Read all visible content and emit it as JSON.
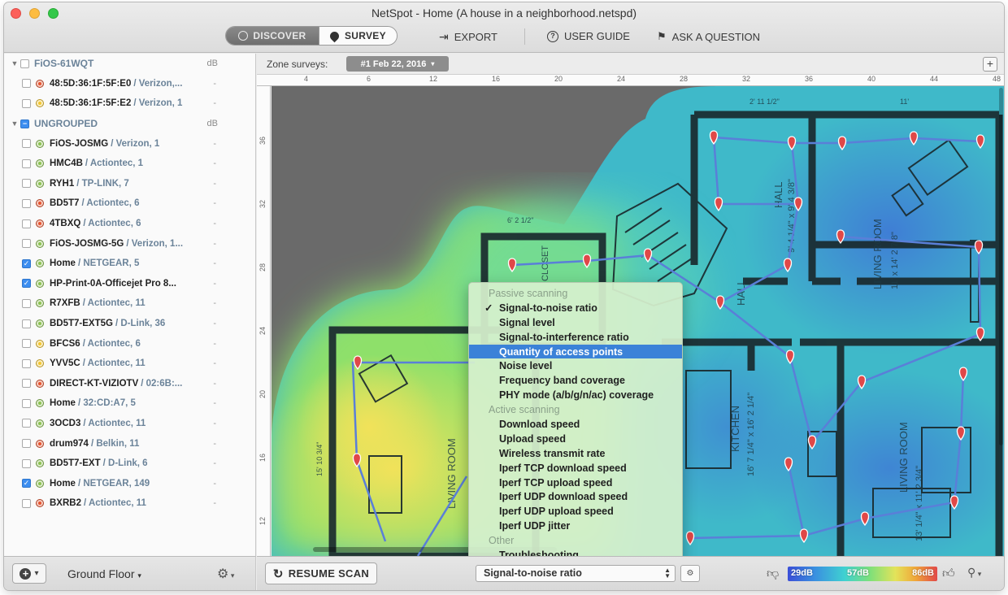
{
  "window": {
    "title": "NetSpot - Home (A house in a neighborhood.netspd)"
  },
  "toolbar": {
    "discover_label": "DISCOVER",
    "survey_label": "SURVEY",
    "export_label": "EXPORT",
    "user_guide_label": "USER GUIDE",
    "ask_label": "ASK A QUESTION"
  },
  "sidebar": {
    "groups": [
      {
        "name": "FiOS-61WQT",
        "unit": "dB",
        "items": [
          {
            "name": "48:5D:36:1F:5F:E0",
            "vendor": "/ Verizon,...",
            "value": "-",
            "color": "#e4542f",
            "checked": false
          },
          {
            "name": "48:5D:36:1F:5F:E2",
            "vendor": "/ Verizon, 1",
            "value": "-",
            "color": "#f2c531",
            "checked": false
          }
        ]
      },
      {
        "name": "UNGROUPED",
        "unit": "dB",
        "items": [
          {
            "name": "FiOS-JOSMG",
            "vendor": "/ Verizon, 1",
            "value": "-",
            "color": "#8cc152",
            "checked": false
          },
          {
            "name": "HMC4B",
            "vendor": "/ Actiontec, 1",
            "value": "-",
            "color": "#8cc152",
            "checked": false
          },
          {
            "name": "RYH1",
            "vendor": "/ TP-LINK, 7",
            "value": "-",
            "color": "#8cc152",
            "checked": false
          },
          {
            "name": "BD5T7",
            "vendor": "/ Actiontec, 6",
            "value": "-",
            "color": "#e4542f",
            "checked": false
          },
          {
            "name": "4TBXQ",
            "vendor": "/ Actiontec, 6",
            "value": "-",
            "color": "#e4542f",
            "checked": false
          },
          {
            "name": "FiOS-JOSMG-5G",
            "vendor": "/ Verizon, 1...",
            "value": "-",
            "color": "#8cc152",
            "checked": false
          },
          {
            "name": "Home",
            "vendor": "/ NETGEAR, 5",
            "value": "-",
            "color": "#8cc152",
            "checked": true
          },
          {
            "name": "HP-Print-0A-Officejet Pro 8...",
            "vendor": "",
            "value": "-",
            "color": "#8cc152",
            "checked": true
          },
          {
            "name": "R7XFB",
            "vendor": "/ Actiontec, 11",
            "value": "-",
            "color": "#8cc152",
            "checked": false
          },
          {
            "name": "BD5T7-EXT5G",
            "vendor": "/ D-Link, 36",
            "value": "-",
            "color": "#8cc152",
            "checked": false
          },
          {
            "name": "BFCS6",
            "vendor": "/ Actiontec, 6",
            "value": "-",
            "color": "#f2c531",
            "checked": false
          },
          {
            "name": "YVV5C",
            "vendor": "/ Actiontec, 11",
            "value": "-",
            "color": "#f2c531",
            "checked": false
          },
          {
            "name": "DIRECT-KT-VIZIOTV",
            "vendor": "/ 02:6B:...",
            "value": "-",
            "color": "#e4542f",
            "checked": false
          },
          {
            "name": "Home",
            "vendor": "/ 32:CD:A7, 5",
            "value": "-",
            "color": "#8cc152",
            "checked": false
          },
          {
            "name": "3OCD3",
            "vendor": "/ Actiontec, 11",
            "value": "-",
            "color": "#8cc152",
            "checked": false
          },
          {
            "name": "drum974",
            "vendor": "/ Belkin, 11",
            "value": "-",
            "color": "#e4542f",
            "checked": false
          },
          {
            "name": "BD5T7-EXT",
            "vendor": "/ D-Link, 6",
            "value": "-",
            "color": "#8cc152",
            "checked": false
          },
          {
            "name": "Home",
            "vendor": "/ NETGEAR, 149",
            "value": "-",
            "color": "#8cc152",
            "checked": true
          },
          {
            "name": "BXRB2",
            "vendor": "/ Actiontec, 11",
            "value": "-",
            "color": "#e4542f",
            "checked": false
          }
        ]
      }
    ],
    "floor_label": "Ground Floor"
  },
  "zone": {
    "label": "Zone surveys:",
    "selected": "#1 Feb 22, 2016"
  },
  "rulers": {
    "h_ticks": [
      "4",
      "6",
      "12",
      "16",
      "20",
      "24",
      "28",
      "32",
      "36",
      "40",
      "44",
      "48"
    ],
    "v_ticks": [
      "36",
      "32",
      "28",
      "24",
      "20",
      "16",
      "12"
    ]
  },
  "plan_labels": {
    "hall": "HALL",
    "hall2": "HALL",
    "living_room_1": "LIVING ROOM",
    "living_room_1_dim": "11' x 14' 2 7/8\"",
    "kitchen": "KITCHEN",
    "kitchen_dim": "16' 7 1/4\" x 16' 2 1/4\"",
    "living_room_2": "LIVING ROOM",
    "living_room_2_dim": "13' 1/4\" x 11' 2 3/4\"",
    "living_room_3": "LIVING ROOM",
    "living_room_3_dim": "15' 10 3/4\"",
    "closet": "CLOSET",
    "hall_dim": "9' 4 1/4\" x 9' 4 3/8\"",
    "dim_top_right": "11'",
    "dim_top_mid": "2' 11 1/2\"",
    "dim_closet": "6' 2 1/2\""
  },
  "menu": {
    "passive_header": "Passive scanning",
    "passive_items": [
      "Signal-to-noise ratio",
      "Signal level",
      "Signal-to-interference ratio",
      "Quantity of access points",
      "Noise level",
      "Frequency band coverage",
      "PHY mode (a/b/g/n/ac) coverage"
    ],
    "active_header": "Active scanning",
    "active_items": [
      "Download speed",
      "Upload speed",
      "Wireless transmit rate",
      "Iperf TCP download speed",
      "Iperf TCP upload speed",
      "Iperf UDP download speed",
      "Iperf UDP upload speed",
      "Iperf UDP jitter"
    ],
    "other_header": "Other",
    "other_items": [
      "Troubleshooting"
    ],
    "checked_item": "Signal-to-noise ratio",
    "highlighted_item": "Quantity of access points"
  },
  "bottom": {
    "resume_label": "RESUME SCAN",
    "visualization": "Signal-to-noise ratio",
    "legend_min": "29dB",
    "legend_mid": "57dB",
    "legend_max": "86dB"
  }
}
